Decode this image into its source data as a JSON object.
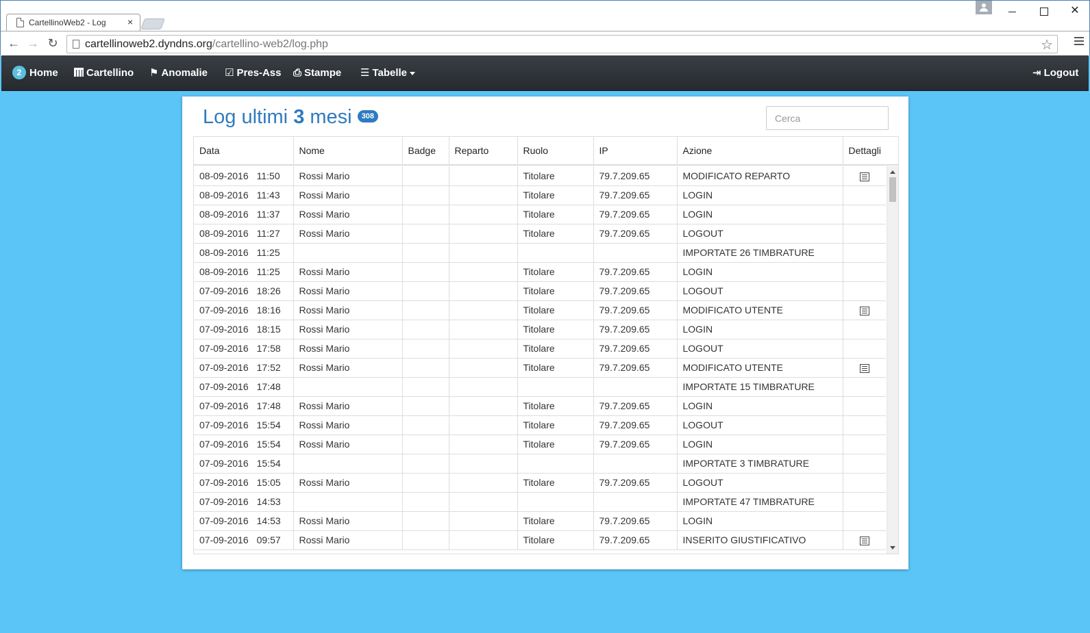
{
  "browser": {
    "tab_title": "CartellinoWeb2 - Log",
    "tab_close": "×",
    "url_host": "cartellinoweb2.dyndns.org",
    "url_path": "/cartellino-web2/log.php",
    "close_glyph": "✕"
  },
  "navbar": {
    "home_badge": "2",
    "home": "Home",
    "cartellino": "Cartellino",
    "anomalie": "Anomalie",
    "pres_ass": "Pres-Ass",
    "stampe": "Stampe",
    "tabelle": "Tabelle",
    "logout": "Logout"
  },
  "page": {
    "title_prefix": "Log ultimi",
    "title_number": "3",
    "title_suffix": "mesi",
    "count": "308",
    "search_placeholder": "Cerca"
  },
  "table": {
    "columns": [
      "Data",
      "Nome",
      "Badge",
      "Reparto",
      "Ruolo",
      "IP",
      "Azione",
      "Dettagli"
    ],
    "rows": [
      {
        "date": "08-09-2016",
        "time": "11:50",
        "nome": "Rossi Mario",
        "badge": "",
        "reparto": "",
        "ruolo": "Titolare",
        "ip": "79.7.209.65",
        "azione": "MODIFICATO REPARTO",
        "dettagli": true
      },
      {
        "date": "08-09-2016",
        "time": "11:43",
        "nome": "Rossi Mario",
        "badge": "",
        "reparto": "",
        "ruolo": "Titolare",
        "ip": "79.7.209.65",
        "azione": "LOGIN",
        "dettagli": false
      },
      {
        "date": "08-09-2016",
        "time": "11:37",
        "nome": "Rossi Mario",
        "badge": "",
        "reparto": "",
        "ruolo": "Titolare",
        "ip": "79.7.209.65",
        "azione": "LOGIN",
        "dettagli": false
      },
      {
        "date": "08-09-2016",
        "time": "11:27",
        "nome": "Rossi Mario",
        "badge": "",
        "reparto": "",
        "ruolo": "Titolare",
        "ip": "79.7.209.65",
        "azione": "LOGOUT",
        "dettagli": false
      },
      {
        "date": "08-09-2016",
        "time": "11:25",
        "nome": "",
        "badge": "",
        "reparto": "",
        "ruolo": "",
        "ip": "",
        "azione": "IMPORTATE 26 TIMBRATURE",
        "dettagli": false
      },
      {
        "date": "08-09-2016",
        "time": "11:25",
        "nome": "Rossi Mario",
        "badge": "",
        "reparto": "",
        "ruolo": "Titolare",
        "ip": "79.7.209.65",
        "azione": "LOGIN",
        "dettagli": false
      },
      {
        "date": "07-09-2016",
        "time": "18:26",
        "nome": "Rossi Mario",
        "badge": "",
        "reparto": "",
        "ruolo": "Titolare",
        "ip": "79.7.209.65",
        "azione": "LOGOUT",
        "dettagli": false
      },
      {
        "date": "07-09-2016",
        "time": "18:16",
        "nome": "Rossi Mario",
        "badge": "",
        "reparto": "",
        "ruolo": "Titolare",
        "ip": "79.7.209.65",
        "azione": "MODIFICATO UTENTE",
        "dettagli": true
      },
      {
        "date": "07-09-2016",
        "time": "18:15",
        "nome": "Rossi Mario",
        "badge": "",
        "reparto": "",
        "ruolo": "Titolare",
        "ip": "79.7.209.65",
        "azione": "LOGIN",
        "dettagli": false
      },
      {
        "date": "07-09-2016",
        "time": "17:58",
        "nome": "Rossi Mario",
        "badge": "",
        "reparto": "",
        "ruolo": "Titolare",
        "ip": "79.7.209.65",
        "azione": "LOGOUT",
        "dettagli": false
      },
      {
        "date": "07-09-2016",
        "time": "17:52",
        "nome": "Rossi Mario",
        "badge": "",
        "reparto": "",
        "ruolo": "Titolare",
        "ip": "79.7.209.65",
        "azione": "MODIFICATO UTENTE",
        "dettagli": true
      },
      {
        "date": "07-09-2016",
        "time": "17:48",
        "nome": "",
        "badge": "",
        "reparto": "",
        "ruolo": "",
        "ip": "",
        "azione": "IMPORTATE 15 TIMBRATURE",
        "dettagli": false
      },
      {
        "date": "07-09-2016",
        "time": "17:48",
        "nome": "Rossi Mario",
        "badge": "",
        "reparto": "",
        "ruolo": "Titolare",
        "ip": "79.7.209.65",
        "azione": "LOGIN",
        "dettagli": false
      },
      {
        "date": "07-09-2016",
        "time": "15:54",
        "nome": "Rossi Mario",
        "badge": "",
        "reparto": "",
        "ruolo": "Titolare",
        "ip": "79.7.209.65",
        "azione": "LOGOUT",
        "dettagli": false
      },
      {
        "date": "07-09-2016",
        "time": "15:54",
        "nome": "Rossi Mario",
        "badge": "",
        "reparto": "",
        "ruolo": "Titolare",
        "ip": "79.7.209.65",
        "azione": "LOGIN",
        "dettagli": false
      },
      {
        "date": "07-09-2016",
        "time": "15:54",
        "nome": "",
        "badge": "",
        "reparto": "",
        "ruolo": "",
        "ip": "",
        "azione": "IMPORTATE 3 TIMBRATURE",
        "dettagli": false
      },
      {
        "date": "07-09-2016",
        "time": "15:05",
        "nome": "Rossi Mario",
        "badge": "",
        "reparto": "",
        "ruolo": "Titolare",
        "ip": "79.7.209.65",
        "azione": "LOGOUT",
        "dettagli": false
      },
      {
        "date": "07-09-2016",
        "time": "14:53",
        "nome": "",
        "badge": "",
        "reparto": "",
        "ruolo": "",
        "ip": "",
        "azione": "IMPORTATE 47 TIMBRATURE",
        "dettagli": false
      },
      {
        "date": "07-09-2016",
        "time": "14:53",
        "nome": "Rossi Mario",
        "badge": "",
        "reparto": "",
        "ruolo": "Titolare",
        "ip": "79.7.209.65",
        "azione": "LOGIN",
        "dettagli": false
      },
      {
        "date": "07-09-2016",
        "time": "09:57",
        "nome": "Rossi Mario",
        "badge": "",
        "reparto": "",
        "ruolo": "Titolare",
        "ip": "79.7.209.65",
        "azione": "INSERITO GIUSTIFICATIVO",
        "dettagli": true
      }
    ]
  },
  "colors": {
    "page_bg": "#5bc5f8",
    "navbar_bg": "#2f3439",
    "accent": "#2f7bbf"
  }
}
